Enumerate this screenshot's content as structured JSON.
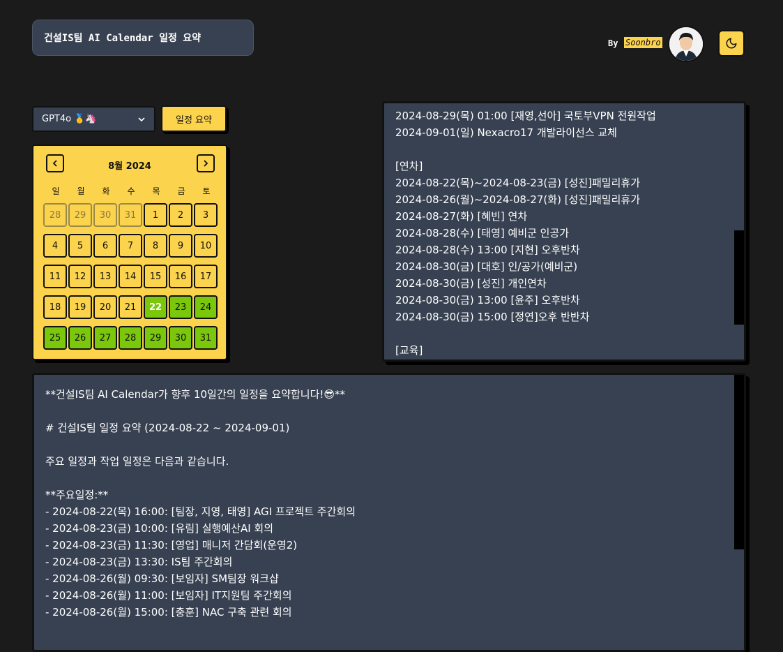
{
  "header": {
    "title": "건설IS팀 AI Calendar 일정 요약",
    "by_label": "By",
    "author": "Soonbro"
  },
  "controls": {
    "model_selected": "GPT4o 🥇🦄",
    "summary_button": "일정 요약"
  },
  "calendar": {
    "month_label": "8월 2024",
    "weekdays": [
      "일",
      "월",
      "화",
      "수",
      "목",
      "금",
      "토"
    ],
    "days": [
      {
        "n": "28",
        "other": true
      },
      {
        "n": "29",
        "other": true
      },
      {
        "n": "30",
        "other": true
      },
      {
        "n": "31",
        "other": true
      },
      {
        "n": "1"
      },
      {
        "n": "2"
      },
      {
        "n": "3"
      },
      {
        "n": "4"
      },
      {
        "n": "5"
      },
      {
        "n": "6"
      },
      {
        "n": "7"
      },
      {
        "n": "8"
      },
      {
        "n": "9"
      },
      {
        "n": "10"
      },
      {
        "n": "11"
      },
      {
        "n": "12"
      },
      {
        "n": "13"
      },
      {
        "n": "14"
      },
      {
        "n": "15"
      },
      {
        "n": "16"
      },
      {
        "n": "17"
      },
      {
        "n": "18"
      },
      {
        "n": "19"
      },
      {
        "n": "20"
      },
      {
        "n": "21"
      },
      {
        "n": "22",
        "sel": true,
        "today": true
      },
      {
        "n": "23",
        "sel": true
      },
      {
        "n": "24",
        "sel": true
      },
      {
        "n": "25",
        "sel": true
      },
      {
        "n": "26",
        "sel": true
      },
      {
        "n": "27",
        "sel": true
      },
      {
        "n": "28",
        "sel": true
      },
      {
        "n": "29",
        "sel": true
      },
      {
        "n": "30",
        "sel": true
      },
      {
        "n": "31",
        "sel": true
      }
    ]
  },
  "schedule_lines": [
    "2024-08-29(목) 01:00 [재영,선아] 국토부VPN 전원작업",
    "2024-09-01(일) Nexacro17 개발라이선스 교체",
    "",
    "[연차]",
    "2024-08-22(목)~2024-08-23(금) [성진]패밀리휴가",
    "2024-08-26(월)~2024-08-27(화) [성진]패밀리휴가",
    "2024-08-27(화) [혜빈] 연차",
    "2024-08-28(수) [태영] 예비군 인공가",
    "2024-08-28(수) 13:00 [지현] 오후반차",
    "2024-08-30(금) [대호] 인/공가(예비군)",
    "2024-08-30(금) [성진] 개인연차",
    "2024-08-30(금) 13:00 [윤주] 오후반차",
    "2024-08-30(금) 15:00 [정연]오후 반반차",
    "",
    "[교육]"
  ],
  "summary_lines": [
    "**건설IS팀 AI Calendar가 향후 10일간의 일정을 요약합니다!😎**",
    "",
    "# 건설IS팀 일정 요약 (2024-08-22 ~ 2024-09-01)",
    "",
    "주요 일정과 작업 일정은 다음과 같습니다.",
    "",
    "**주요일정:**",
    "- 2024-08-22(목) 16:00: [팀장, 지영, 태영] AGI 프로젝트 주간회의",
    "- 2024-08-23(금) 10:00: [유림] 실행예산AI 회의",
    "- 2024-08-23(금) 11:30: [영업] 매니저 간담회(운영2)",
    "- 2024-08-23(금) 13:30: IS팀 주간회의",
    "- 2024-08-26(월) 09:30: [보임자] SM팀장 워크샵",
    "- 2024-08-26(월) 11:00: [보임자] IT지원팀 주간회의",
    "- 2024-08-26(월) 15:00: [충훈] NAC 구축 관련 회의"
  ],
  "colors": {
    "background": "#1b1b1b",
    "panel": "#374151",
    "accent": "#fcd34d",
    "selected_day": "#7ac70c"
  },
  "icons": {
    "prev": "chevron-left-icon",
    "next": "chevron-right-icon",
    "dropdown": "chevron-down-icon",
    "theme": "moon-icon"
  }
}
